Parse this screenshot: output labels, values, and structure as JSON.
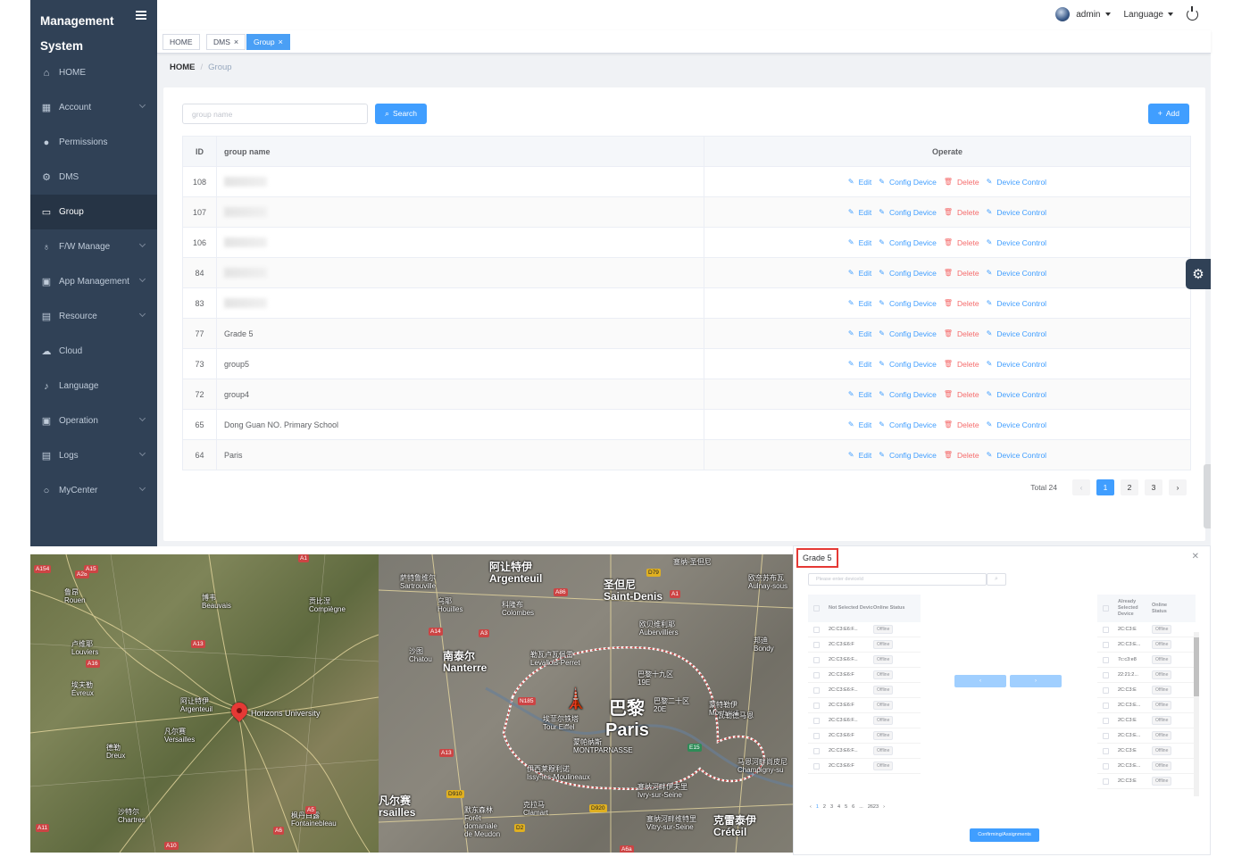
{
  "sidebar": {
    "brand": "Management System",
    "items": [
      {
        "label": "HOME",
        "icon": "home-icon",
        "arrow": false,
        "active": false
      },
      {
        "label": "Account",
        "icon": "grid-icon",
        "arrow": true,
        "active": false
      },
      {
        "label": "Permissions",
        "icon": "user-icon",
        "arrow": false,
        "active": false
      },
      {
        "label": "DMS",
        "icon": "chip-icon",
        "arrow": false,
        "active": false
      },
      {
        "label": "Group",
        "icon": "folder-icon",
        "arrow": false,
        "active": true
      },
      {
        "label": "F/W Manage",
        "icon": "wrench-icon",
        "arrow": true,
        "active": false
      },
      {
        "label": "App Management",
        "icon": "briefcase-icon",
        "arrow": true,
        "active": false
      },
      {
        "label": "Resource",
        "icon": "document-icon",
        "arrow": true,
        "active": false
      },
      {
        "label": "Cloud",
        "icon": "cloud-icon",
        "arrow": false,
        "active": false
      },
      {
        "label": "Language",
        "icon": "microphone-icon",
        "arrow": false,
        "active": false
      },
      {
        "label": "Operation",
        "icon": "briefcase-icon",
        "arrow": true,
        "active": false
      },
      {
        "label": "Logs",
        "icon": "document-icon",
        "arrow": true,
        "active": false
      },
      {
        "label": "MyCenter",
        "icon": "user-outline-icon",
        "arrow": true,
        "active": false
      }
    ]
  },
  "navbar": {
    "user": "admin",
    "language": "Language"
  },
  "tabs": [
    {
      "label": "HOME",
      "closable": false
    },
    {
      "label": "DMS",
      "closable": true
    },
    {
      "label": "Group",
      "closable": true,
      "active": true
    }
  ],
  "breadcrumb": {
    "root": "HOME",
    "current": "Group"
  },
  "toolbar": {
    "search_placeholder": "group name",
    "search_label": "Search",
    "add_label": "Add"
  },
  "table": {
    "headers": {
      "id": "ID",
      "name": "group name",
      "operate": "Operate"
    },
    "rows": [
      {
        "id": "108",
        "name": ""
      },
      {
        "id": "107",
        "name": ""
      },
      {
        "id": "106",
        "name": ""
      },
      {
        "id": "84",
        "name": ""
      },
      {
        "id": "83",
        "name": ""
      },
      {
        "id": "77",
        "name": "Grade 5"
      },
      {
        "id": "73",
        "name": "group5"
      },
      {
        "id": "72",
        "name": "group4"
      },
      {
        "id": "65",
        "name": "Dong Guan NO. Primary School"
      },
      {
        "id": "64",
        "name": "Paris"
      }
    ],
    "actions": {
      "edit": "Edit",
      "config": "Config Device",
      "delete": "Delete",
      "control": "Device Control"
    }
  },
  "pagination": {
    "total": "Total 24",
    "pages": [
      "1",
      "2",
      "3"
    ],
    "current": "1"
  },
  "map_left": {
    "labels": [
      "鲁昂\nRouen",
      "博韦\nBeauvais",
      "贡比涅\nCompiègne",
      "卢维耶\nLouviers",
      "埃夫勒\nÉvreux",
      "阿让特伊\nArgenteuil",
      "凡尔赛\nVersailles",
      "德勒\nDreux",
      "沙特尔\nChartres",
      "枫丹白露\nFontainebleau",
      "Horizons University"
    ],
    "roads": [
      "A28",
      "A16",
      "A13",
      "A15",
      "A10",
      "A6",
      "A5",
      "A11",
      "A154",
      "A1"
    ]
  },
  "map_right": {
    "labels": [
      "萨特鲁维尔\nSartrouville",
      "阿让特伊\nArgenteuil",
      "圣但尼\nSaint-Denis",
      "欧奈苏布瓦\nAulnay-sous",
      "乌耶\nHouilles",
      "科隆布\nColombes",
      "欧贝维利耶\nAubervilliers",
      "邦迪\nBondy",
      "南泰尔\nNanterre",
      "勒瓦卢瓦佩雷\nLevallois-Perret",
      "巴黎十九区\n19E",
      "沙图\nChatou",
      "巴黎二十区\n20E",
      "蒙特勒伊\nMontreuil",
      "埃菲尔铁塔\nTour Eiffel",
      "蒙帕纳斯\nMONTPARNASSE",
      "伊西莱穆利诺\nIssy-les-Moulineaux",
      "塞纳河畔伊夫里\nIvry-sur-Seine",
      "凡尔赛\nrsailles",
      "默东森林\nForêt\ndomaniale\nde Meudon",
      "克拉马\nClamart",
      "塞纳河畔维特里\nVitry-sur-Seine",
      "克雷泰伊\nCréteil",
      "马恩河畔尚皮尼\nChampigny-su",
      "塞纳-圣但尼",
      "瓦勒德马恩"
    ],
    "paris_cn": "巴黎",
    "paris": "Paris",
    "roads": [
      "A86",
      "A1",
      "A14",
      "A3",
      "A13",
      "N185",
      "E15",
      "D910",
      "D920",
      "A6a",
      "D79",
      "D2"
    ]
  },
  "dialog": {
    "title": "Grade 5",
    "search_placeholder": "Please enter deviceId",
    "left_headers": {
      "device": "Not Selected Device",
      "status": "Online Status"
    },
    "right_headers": {
      "device": "Already Selected Device",
      "status": "Online Status"
    },
    "left_rows": [
      {
        "device": "2C:C3:E6:F...",
        "status": "Offline"
      },
      {
        "device": "2C:C3:E6:F",
        "status": "Offline"
      },
      {
        "device": "2C:C3:E6:F...",
        "status": "Offline"
      },
      {
        "device": "2C:C3:E6:F",
        "status": "Offline"
      },
      {
        "device": "2C:C3:E6:F...",
        "status": "Offline"
      },
      {
        "device": "2C:C3:E6:F",
        "status": "Offline"
      },
      {
        "device": "2C:C3:E6:F...",
        "status": "Offline"
      },
      {
        "device": "2C:C3:E6:F",
        "status": "Offline"
      },
      {
        "device": "2C:C3:E6:F...",
        "status": "Offline"
      },
      {
        "device": "2C:C3:E6:F",
        "status": "Offline"
      }
    ],
    "right_rows": [
      {
        "device": "2C:C3:E",
        "status": "Offline"
      },
      {
        "device": "2C:C3:E...",
        "status": "Offline"
      },
      {
        "device": "7c:c3:e8",
        "status": "Offline"
      },
      {
        "device": "22:21:2...",
        "status": "Offline"
      },
      {
        "device": "2C:C3:E",
        "status": "Offline"
      },
      {
        "device": "2C:C3:E...",
        "status": "Offline"
      },
      {
        "device": "2C:C3:E",
        "status": "Offline"
      },
      {
        "device": "2C:C3:E...",
        "status": "Offline"
      },
      {
        "device": "2C:C3:E",
        "status": "Offline"
      },
      {
        "device": "2C:C3:E...",
        "status": "Offline"
      },
      {
        "device": "2C:C3:E",
        "status": "Offline"
      }
    ],
    "move_left": "‹",
    "move_right": "›",
    "pager": [
      "‹",
      "1",
      "2",
      "3",
      "4",
      "5",
      "6",
      "...",
      "2623",
      "›"
    ],
    "confirm": "Confirming/Assignments"
  },
  "colors": {
    "sidebar_bg": "#304156",
    "primary": "#409eff",
    "danger": "#f56c6c",
    "highlight_box": "#e53935"
  }
}
